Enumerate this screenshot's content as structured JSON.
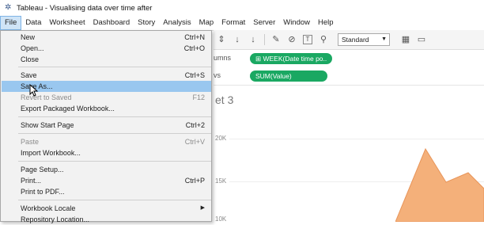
{
  "window": {
    "title": "Tableau - Visualising data over time after",
    "logo_icon": "tableau-logo-icon"
  },
  "menubar": [
    "File",
    "Data",
    "Worksheet",
    "Dashboard",
    "Story",
    "Analysis",
    "Map",
    "Format",
    "Server",
    "Window",
    "Help"
  ],
  "toolbar": {
    "fit_select": "Standard"
  },
  "shelves": {
    "columns": {
      "label": "umns",
      "pill": "WEEK(Date time po..",
      "pill_icon": "plus-box-icon"
    },
    "rows": {
      "label": "vs",
      "pill": "SUM(Value)"
    }
  },
  "sheet": {
    "title": "et 3",
    "yticks": [
      "20K",
      "15K",
      "10K"
    ]
  },
  "file_menu": {
    "items": [
      {
        "label": "New",
        "shortcut": "Ctrl+N"
      },
      {
        "label": "Open...",
        "shortcut": "Ctrl+O"
      },
      {
        "label": "Close",
        "shortcut": ""
      },
      {
        "label": "Save",
        "shortcut": "Ctrl+S"
      },
      {
        "label": "Save As...",
        "shortcut": ""
      },
      {
        "label": "Revert to Saved",
        "shortcut": "F12"
      },
      {
        "label": "Export Packaged Workbook...",
        "shortcut": ""
      },
      {
        "label": "Show Start Page",
        "shortcut": "Ctrl+2"
      },
      {
        "label": "Paste",
        "shortcut": "Ctrl+V"
      },
      {
        "label": "Import Workbook...",
        "shortcut": ""
      },
      {
        "label": "Page Setup...",
        "shortcut": ""
      },
      {
        "label": "Print...",
        "shortcut": "Ctrl+P"
      },
      {
        "label": "Print to PDF...",
        "shortcut": ""
      },
      {
        "label": "Workbook Locale",
        "shortcut": ""
      },
      {
        "label": "Repository Location...",
        "shortcut": ""
      }
    ]
  },
  "colors": {
    "pill_green": "#1aa862",
    "highlight": "#99c7ef",
    "area_fill": "#f4b07a"
  }
}
